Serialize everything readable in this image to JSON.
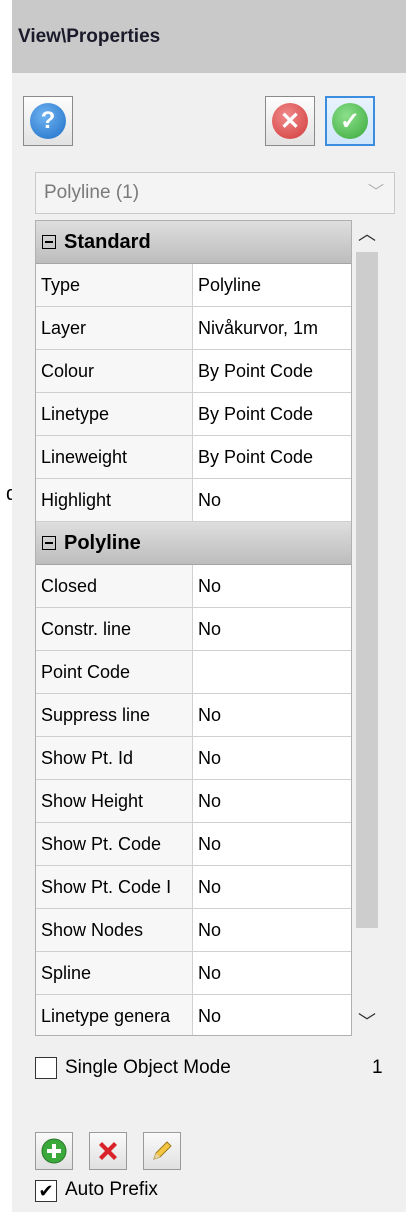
{
  "stray_char": "d",
  "title": "View\\Properties",
  "buttons": {
    "help": "?",
    "cancel": "✕",
    "ok": "✓"
  },
  "combo": {
    "value": "Polyline (1)"
  },
  "sections": [
    {
      "title": "Standard",
      "rows": [
        {
          "key": "Type",
          "value": "Polyline"
        },
        {
          "key": "Layer",
          "value": "Nivåkurvor, 1m"
        },
        {
          "key": "Colour",
          "value": "By Point Code"
        },
        {
          "key": "Linetype",
          "value": "By Point Code"
        },
        {
          "key": "Lineweight",
          "value": "By Point Code"
        },
        {
          "key": "Highlight",
          "value": "No"
        }
      ]
    },
    {
      "title": "Polyline",
      "rows": [
        {
          "key": "Closed",
          "value": "No"
        },
        {
          "key": "Constr. line",
          "value": "No"
        },
        {
          "key": "Point Code",
          "value": ""
        },
        {
          "key": "Suppress line",
          "value": "No"
        },
        {
          "key": "Show Pt. Id",
          "value": "No"
        },
        {
          "key": "Show Height",
          "value": "No"
        },
        {
          "key": "Show Pt. Code",
          "value": "No"
        },
        {
          "key": "Show Pt. Code I",
          "value": "No"
        },
        {
          "key": "Show Nodes",
          "value": "No"
        },
        {
          "key": "Spline",
          "value": "No"
        },
        {
          "key": "Linetype genera",
          "value": "No"
        }
      ]
    }
  ],
  "single_object_mode": {
    "label": "Single Object Mode",
    "checked": false,
    "count": "1"
  },
  "auto_prefix": {
    "label": "Auto Prefix",
    "checked": true,
    "mark": "✔"
  },
  "colors": {
    "help": "#1e6fc8",
    "cancel": "#d23a3a",
    "ok": "#3aa83a",
    "titlebar": "#c9c9c9"
  }
}
